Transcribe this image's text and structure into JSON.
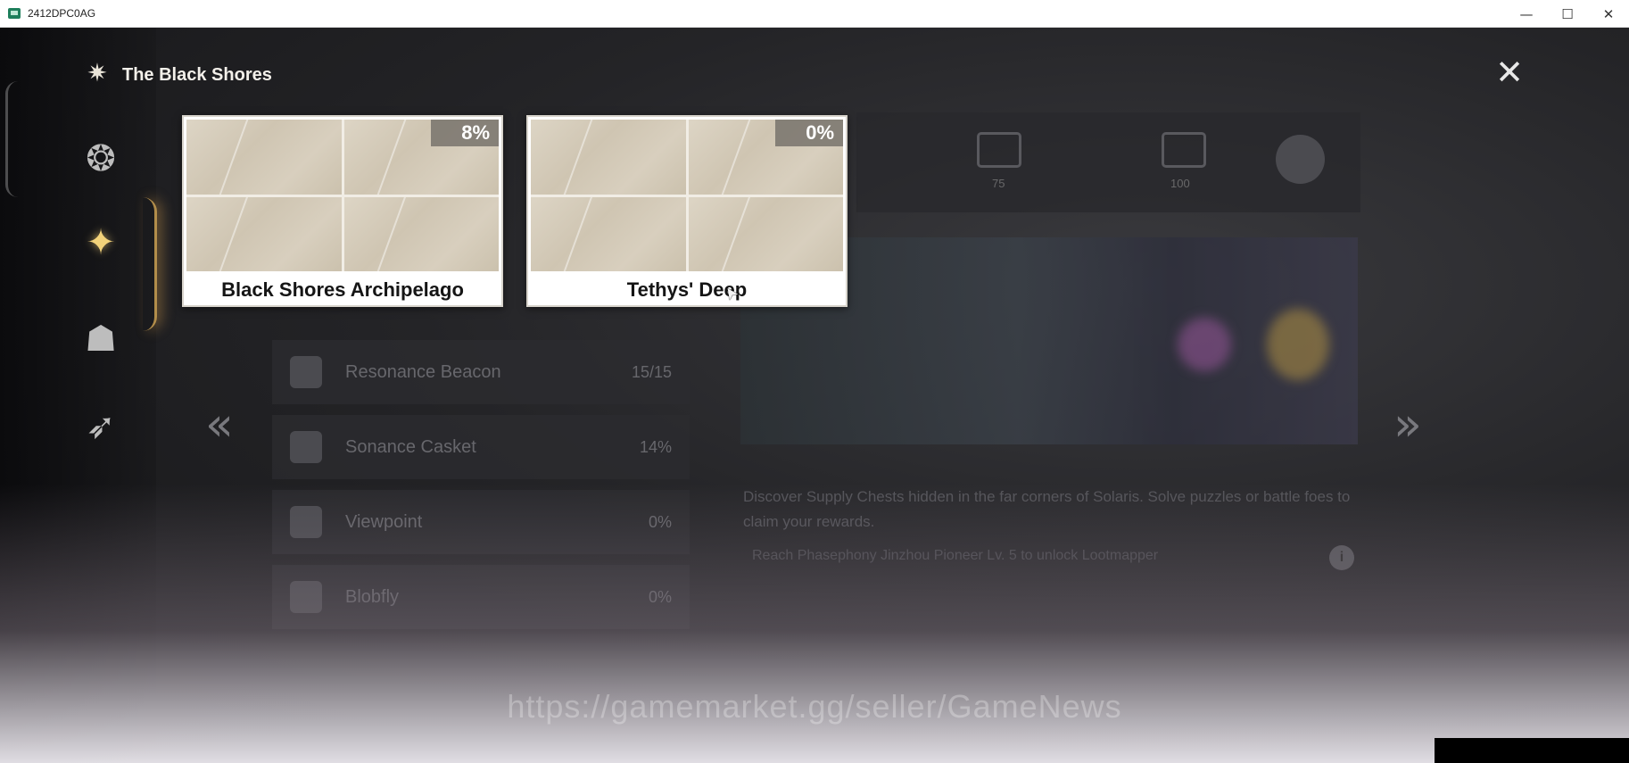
{
  "window": {
    "title": "2412DPC0AG",
    "minimize_glyph": "—",
    "maximize_glyph": "☐",
    "close_glyph": "✕"
  },
  "header": {
    "title": "The Black Shores",
    "icon": "star-emblem-icon"
  },
  "close_button": {
    "glyph": "✕",
    "icon": "close-icon"
  },
  "nav": [
    {
      "icon": "dragon-emblem-icon",
      "glyph": "❂",
      "active": false
    },
    {
      "icon": "star-emblem-icon",
      "glyph": "✦",
      "active": true
    },
    {
      "icon": "tower-emblem-icon",
      "glyph": "☗",
      "active": false
    },
    {
      "icon": "wing-emblem-icon",
      "glyph": "➶",
      "active": false
    }
  ],
  "regions": [
    {
      "name": "Black Shores Archipelago",
      "percent": "8%"
    },
    {
      "name": "Tethys' Deep",
      "percent": "0%"
    }
  ],
  "background": {
    "top_counts": [
      "75",
      "100"
    ],
    "list": [
      {
        "label": "Resonance Beacon",
        "value": "15/15"
      },
      {
        "label": "Sonance Casket",
        "value": "14%"
      },
      {
        "label": "Viewpoint",
        "value": "0%"
      },
      {
        "label": "Blobfly",
        "value": "0%"
      }
    ],
    "description": "Discover Supply Chests hidden in the far corners of Solaris. Solve puzzles or battle foes to claim your rewards.",
    "note": "Reach Phasephony Jinzhou Pioneer Lv. 5 to unlock Lootmapper",
    "info_glyph": "i"
  },
  "arrows": {
    "prev": "«",
    "next": "»"
  },
  "watermark": "https://gamemarket.gg/seller/GameNews"
}
